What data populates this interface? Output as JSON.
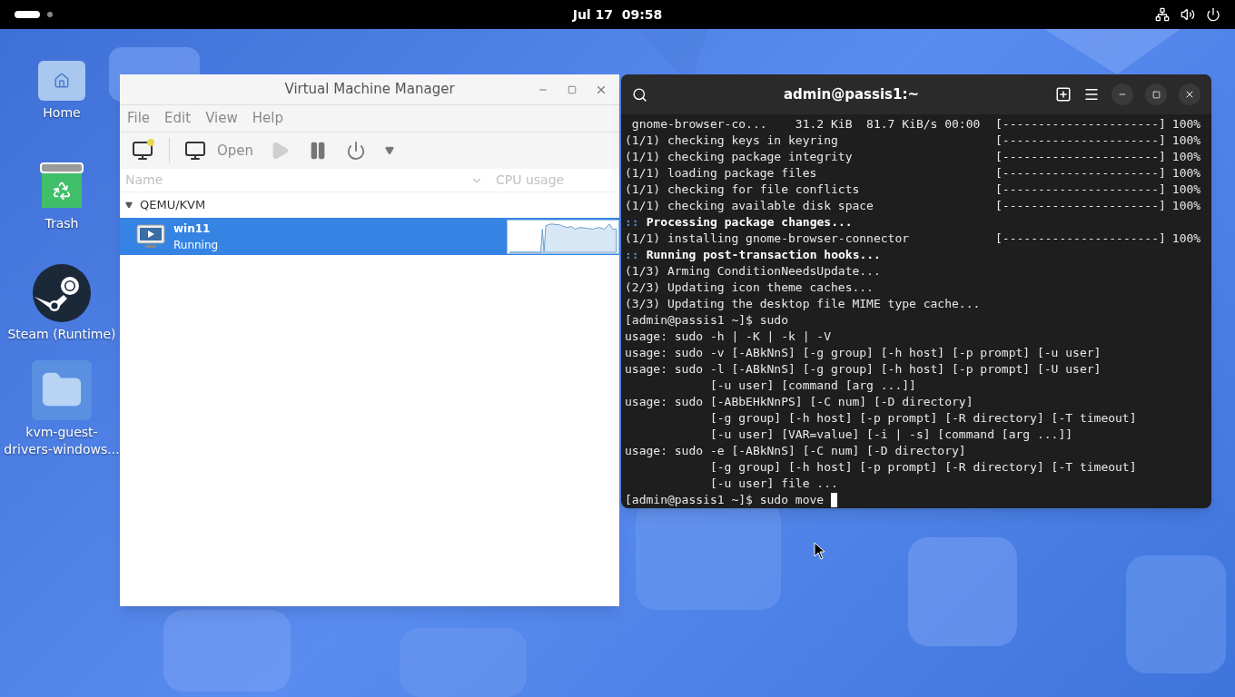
{
  "top_bar": {
    "clock": "Jul 17  09:58"
  },
  "desktop_icons": [
    {
      "kind": "home",
      "label": "Home"
    },
    {
      "kind": "trash",
      "label": "Trash"
    },
    {
      "kind": "steam",
      "label": "Steam (Runtime)"
    },
    {
      "kind": "folder",
      "label": "kvm-guest-drivers-windows..."
    }
  ],
  "vmm": {
    "title": "Virtual Machine Manager",
    "menu": [
      "File",
      "Edit",
      "View",
      "Help"
    ],
    "toolbar": {
      "open_label": "Open",
      "run_disabled": true
    },
    "columns": [
      "Name",
      "CPU usage"
    ],
    "groups": [
      {
        "name": "QEMU/KVM",
        "expanded": true,
        "vms": [
          {
            "name": "win11",
            "status": "Running",
            "selected": true
          }
        ]
      }
    ]
  },
  "terminal": {
    "title": "admin@passis1:~",
    "lines": [
      {
        "kind": "progress",
        "text": " gnome-browser-co...    31.2 KiB  81.7 KiB/s 00:00",
        "bar": "[----------------------]",
        "percent": "100%"
      },
      {
        "kind": "progress",
        "text": "(1/1) checking keys in keyring",
        "bar": "[----------------------]",
        "percent": "100%"
      },
      {
        "kind": "progress",
        "text": "(1/1) checking package integrity",
        "bar": "[----------------------]",
        "percent": "100%"
      },
      {
        "kind": "progress",
        "text": "(1/1) loading package files",
        "bar": "[----------------------]",
        "percent": "100%"
      },
      {
        "kind": "progress",
        "text": "(1/1) checking for file conflicts",
        "bar": "[----------------------]",
        "percent": "100%"
      },
      {
        "kind": "progress",
        "text": "(1/1) checking available disk space",
        "bar": "[----------------------]",
        "percent": "100%"
      },
      {
        "kind": "heading",
        "marker": "::",
        "text": "Processing package changes..."
      },
      {
        "kind": "progress",
        "text": "(1/1) installing gnome-browser-connector",
        "bar": "[----------------------]",
        "percent": "100%"
      },
      {
        "kind": "heading",
        "marker": "::",
        "text": "Running post-transaction hooks..."
      },
      {
        "kind": "plain",
        "text": "(1/3) Arming ConditionNeedsUpdate..."
      },
      {
        "kind": "plain",
        "text": "(2/3) Updating icon theme caches..."
      },
      {
        "kind": "plain",
        "text": "(3/3) Updating the desktop file MIME type cache..."
      },
      {
        "kind": "plain",
        "text": "[admin@passis1 ~]$ sudo"
      },
      {
        "kind": "plain",
        "text": "usage: sudo -h | -K | -k | -V"
      },
      {
        "kind": "plain",
        "text": "usage: sudo -v [-ABkNnS] [-g group] [-h host] [-p prompt] [-u user]"
      },
      {
        "kind": "plain",
        "text": "usage: sudo -l [-ABkNnS] [-g group] [-h host] [-p prompt] [-U user]"
      },
      {
        "kind": "plain",
        "text": "            [-u user] [command [arg ...]]"
      },
      {
        "kind": "plain",
        "text": "usage: sudo [-ABbEHkNnPS] [-C num] [-D directory]"
      },
      {
        "kind": "plain",
        "text": "            [-g group] [-h host] [-p prompt] [-R directory] [-T timeout]"
      },
      {
        "kind": "plain",
        "text": "            [-u user] [VAR=value] [-i | -s] [command [arg ...]]"
      },
      {
        "kind": "plain",
        "text": "usage: sudo -e [-ABkNnS] [-C num] [-D directory]"
      },
      {
        "kind": "plain",
        "text": "            [-g group] [-h host] [-p prompt] [-R directory] [-T timeout]"
      },
      {
        "kind": "plain",
        "text": "            [-u user] file ..."
      },
      {
        "kind": "prompt",
        "text": "[admin@passis1 ~]$ sudo move"
      }
    ]
  }
}
